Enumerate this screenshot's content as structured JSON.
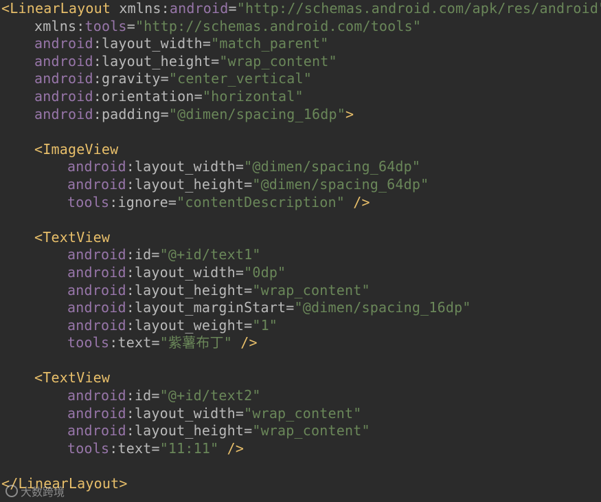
{
  "lines": [
    {
      "indent": 0,
      "parts": [
        {
          "t": "tag",
          "v": "<LinearLayout "
        },
        {
          "t": "attr",
          "v": "xmlns"
        },
        {
          "t": "punc",
          "v": ":"
        },
        {
          "t": "ns",
          "v": "android"
        },
        {
          "t": "eq",
          "v": "="
        },
        {
          "t": "str",
          "v": "\"http://schemas.android.com/apk/res/android\""
        }
      ]
    },
    {
      "indent": 1,
      "parts": [
        {
          "t": "attr",
          "v": "xmlns"
        },
        {
          "t": "punc",
          "v": ":"
        },
        {
          "t": "ns",
          "v": "tools"
        },
        {
          "t": "eq",
          "v": "="
        },
        {
          "t": "str",
          "v": "\"http://schemas.android.com/tools\""
        }
      ]
    },
    {
      "indent": 1,
      "parts": [
        {
          "t": "ns",
          "v": "android"
        },
        {
          "t": "punc",
          "v": ":"
        },
        {
          "t": "attr",
          "v": "layout_width"
        },
        {
          "t": "eq",
          "v": "="
        },
        {
          "t": "str",
          "v": "\"match_parent\""
        }
      ]
    },
    {
      "indent": 1,
      "parts": [
        {
          "t": "ns",
          "v": "android"
        },
        {
          "t": "punc",
          "v": ":"
        },
        {
          "t": "attr",
          "v": "layout_height"
        },
        {
          "t": "eq",
          "v": "="
        },
        {
          "t": "str",
          "v": "\"wrap_content\""
        }
      ]
    },
    {
      "indent": 1,
      "parts": [
        {
          "t": "ns",
          "v": "android"
        },
        {
          "t": "punc",
          "v": ":"
        },
        {
          "t": "attr",
          "v": "gravity"
        },
        {
          "t": "eq",
          "v": "="
        },
        {
          "t": "str",
          "v": "\"center_vertical\""
        }
      ]
    },
    {
      "indent": 1,
      "parts": [
        {
          "t": "ns",
          "v": "android"
        },
        {
          "t": "punc",
          "v": ":"
        },
        {
          "t": "attr",
          "v": "orientation"
        },
        {
          "t": "eq",
          "v": "="
        },
        {
          "t": "str",
          "v": "\"horizontal\""
        }
      ]
    },
    {
      "indent": 1,
      "parts": [
        {
          "t": "ns",
          "v": "android"
        },
        {
          "t": "punc",
          "v": ":"
        },
        {
          "t": "attr",
          "v": "padding"
        },
        {
          "t": "eq",
          "v": "="
        },
        {
          "t": "str",
          "v": "\"@dimen/spacing_16dp\""
        },
        {
          "t": "tag",
          "v": ">"
        }
      ]
    },
    {
      "indent": 0,
      "parts": []
    },
    {
      "indent": 1,
      "parts": [
        {
          "t": "tag",
          "v": "<ImageView"
        }
      ]
    },
    {
      "indent": 2,
      "parts": [
        {
          "t": "ns",
          "v": "android"
        },
        {
          "t": "punc",
          "v": ":"
        },
        {
          "t": "attr",
          "v": "layout_width"
        },
        {
          "t": "eq",
          "v": "="
        },
        {
          "t": "str",
          "v": "\"@dimen/spacing_64dp\""
        }
      ]
    },
    {
      "indent": 2,
      "parts": [
        {
          "t": "ns",
          "v": "android"
        },
        {
          "t": "punc",
          "v": ":"
        },
        {
          "t": "attr",
          "v": "layout_height"
        },
        {
          "t": "eq",
          "v": "="
        },
        {
          "t": "str",
          "v": "\"@dimen/spacing_64dp\""
        }
      ]
    },
    {
      "indent": 2,
      "parts": [
        {
          "t": "ns",
          "v": "tools"
        },
        {
          "t": "punc",
          "v": ":"
        },
        {
          "t": "attr",
          "v": "ignore"
        },
        {
          "t": "eq",
          "v": "="
        },
        {
          "t": "str",
          "v": "\"contentDescription\""
        },
        {
          "t": "tag",
          "v": " />"
        }
      ]
    },
    {
      "indent": 0,
      "parts": []
    },
    {
      "indent": 1,
      "parts": [
        {
          "t": "tag",
          "v": "<TextView"
        }
      ]
    },
    {
      "indent": 2,
      "parts": [
        {
          "t": "ns",
          "v": "android"
        },
        {
          "t": "punc",
          "v": ":"
        },
        {
          "t": "attr",
          "v": "id"
        },
        {
          "t": "eq",
          "v": "="
        },
        {
          "t": "str",
          "v": "\"@+id/text1\""
        }
      ]
    },
    {
      "indent": 2,
      "parts": [
        {
          "t": "ns",
          "v": "android"
        },
        {
          "t": "punc",
          "v": ":"
        },
        {
          "t": "attr",
          "v": "layout_width"
        },
        {
          "t": "eq",
          "v": "="
        },
        {
          "t": "str",
          "v": "\"0dp\""
        }
      ]
    },
    {
      "indent": 2,
      "parts": [
        {
          "t": "ns",
          "v": "android"
        },
        {
          "t": "punc",
          "v": ":"
        },
        {
          "t": "attr",
          "v": "layout_height"
        },
        {
          "t": "eq",
          "v": "="
        },
        {
          "t": "str",
          "v": "\"wrap_content\""
        }
      ]
    },
    {
      "indent": 2,
      "parts": [
        {
          "t": "ns",
          "v": "android"
        },
        {
          "t": "punc",
          "v": ":"
        },
        {
          "t": "attr",
          "v": "layout_marginStart"
        },
        {
          "t": "eq",
          "v": "="
        },
        {
          "t": "str",
          "v": "\"@dimen/spacing_16dp\""
        }
      ]
    },
    {
      "indent": 2,
      "parts": [
        {
          "t": "ns",
          "v": "android"
        },
        {
          "t": "punc",
          "v": ":"
        },
        {
          "t": "attr",
          "v": "layout_weight"
        },
        {
          "t": "eq",
          "v": "="
        },
        {
          "t": "str",
          "v": "\"1\""
        }
      ]
    },
    {
      "indent": 2,
      "parts": [
        {
          "t": "ns",
          "v": "tools"
        },
        {
          "t": "punc",
          "v": ":"
        },
        {
          "t": "attr",
          "v": "text"
        },
        {
          "t": "eq",
          "v": "="
        },
        {
          "t": "str",
          "v": "\"紫薯布丁\""
        },
        {
          "t": "tag",
          "v": " />"
        }
      ]
    },
    {
      "indent": 0,
      "parts": []
    },
    {
      "indent": 1,
      "parts": [
        {
          "t": "tag",
          "v": "<TextView"
        }
      ]
    },
    {
      "indent": 2,
      "parts": [
        {
          "t": "ns",
          "v": "android"
        },
        {
          "t": "punc",
          "v": ":"
        },
        {
          "t": "attr",
          "v": "id"
        },
        {
          "t": "eq",
          "v": "="
        },
        {
          "t": "str",
          "v": "\"@+id/text2\""
        }
      ]
    },
    {
      "indent": 2,
      "parts": [
        {
          "t": "ns",
          "v": "android"
        },
        {
          "t": "punc",
          "v": ":"
        },
        {
          "t": "attr",
          "v": "layout_width"
        },
        {
          "t": "eq",
          "v": "="
        },
        {
          "t": "str",
          "v": "\"wrap_content\""
        }
      ]
    },
    {
      "indent": 2,
      "parts": [
        {
          "t": "ns",
          "v": "android"
        },
        {
          "t": "punc",
          "v": ":"
        },
        {
          "t": "attr",
          "v": "layout_height"
        },
        {
          "t": "eq",
          "v": "="
        },
        {
          "t": "str",
          "v": "\"wrap_content\""
        }
      ]
    },
    {
      "indent": 2,
      "parts": [
        {
          "t": "ns",
          "v": "tools"
        },
        {
          "t": "punc",
          "v": ":"
        },
        {
          "t": "attr",
          "v": "text"
        },
        {
          "t": "eq",
          "v": "="
        },
        {
          "t": "str",
          "v": "\"11:11\""
        },
        {
          "t": "tag",
          "v": " />"
        }
      ]
    },
    {
      "indent": 0,
      "parts": []
    },
    {
      "indent": 0,
      "parts": [
        {
          "t": "tag",
          "v": "</LinearLayout>"
        }
      ]
    }
  ],
  "watermark": {
    "text": "大数跨境",
    "icon": "watermark-logo-icon"
  },
  "colors": {
    "background": "#2b2b2b",
    "tag": "#e8bf6a",
    "namespace": "#9876aa",
    "attribute": "#bababa",
    "string": "#6a8759"
  }
}
